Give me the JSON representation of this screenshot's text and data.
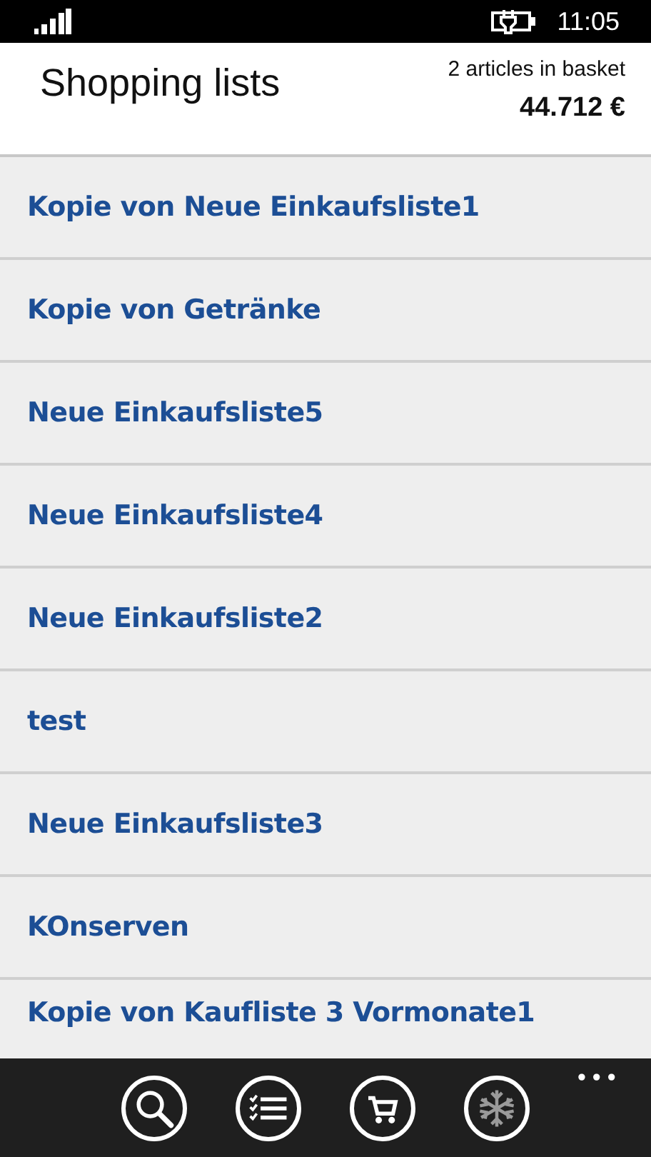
{
  "status_bar": {
    "time": "11:05"
  },
  "header": {
    "title": "Shopping lists",
    "basket_count": "2 articles in basket",
    "basket_total": "44.712 €"
  },
  "lists": [
    {
      "name": "Kopie von Neue Einkaufsliste1"
    },
    {
      "name": "Kopie von Getränke"
    },
    {
      "name": "Neue Einkaufsliste5"
    },
    {
      "name": "Neue Einkaufsliste4"
    },
    {
      "name": "Neue Einkaufsliste2"
    },
    {
      "name": "test"
    },
    {
      "name": "Neue Einkaufsliste3"
    },
    {
      "name": "KOnserven"
    },
    {
      "name": "Kopie von Kaufliste 3 Vormonate1"
    }
  ],
  "app_bar": {
    "more": "•••",
    "buttons": [
      {
        "kind": "search",
        "disabled": false
      },
      {
        "kind": "checklist",
        "disabled": false
      },
      {
        "kind": "cart",
        "disabled": false
      },
      {
        "kind": "snowflake",
        "disabled": true
      }
    ]
  }
}
